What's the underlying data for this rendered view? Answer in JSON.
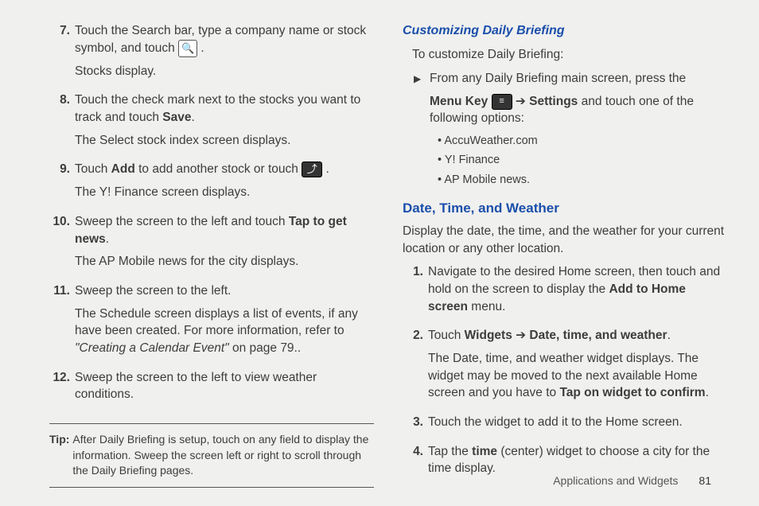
{
  "left": {
    "items": [
      {
        "num": "7.",
        "paras": [
          {
            "segments": [
              {
                "text": "Touch the Search bar, type a company name or stock symbol, and touch "
              },
              {
                "icon": "search"
              },
              {
                "text": " ."
              }
            ]
          },
          {
            "segments": [
              {
                "text": "Stocks display."
              }
            ]
          }
        ]
      },
      {
        "num": "8.",
        "paras": [
          {
            "segments": [
              {
                "text": "Touch the check mark next to the stocks you want to track and touch "
              },
              {
                "bold": true,
                "text": "Save"
              },
              {
                "text": "."
              }
            ]
          },
          {
            "segments": [
              {
                "text": "The Select stock index screen displays."
              }
            ]
          }
        ]
      },
      {
        "num": "9.",
        "paras": [
          {
            "segments": [
              {
                "text": "Touch "
              },
              {
                "bold": true,
                "text": "Add"
              },
              {
                "text": " to add another stock or touch "
              },
              {
                "icon": "return"
              },
              {
                "text": " ."
              }
            ]
          },
          {
            "segments": [
              {
                "text": "The Y! Finance screen displays."
              }
            ]
          }
        ]
      },
      {
        "num": "10.",
        "paras": [
          {
            "segments": [
              {
                "text": "Sweep the screen to the left and touch "
              },
              {
                "bold": true,
                "text": "Tap to get news"
              },
              {
                "text": "."
              }
            ]
          },
          {
            "segments": [
              {
                "text": "The AP Mobile news for the city displays."
              }
            ]
          }
        ]
      },
      {
        "num": "11.",
        "paras": [
          {
            "segments": [
              {
                "text": "Sweep the screen to the left."
              }
            ]
          },
          {
            "segments": [
              {
                "text": "The Schedule screen displays a list of events, if any have been created. For more information, refer to "
              },
              {
                "italic": true,
                "text": "\"Creating a Calendar Event\""
              },
              {
                "text": "  on page 79.."
              }
            ]
          }
        ]
      },
      {
        "num": "12.",
        "paras": [
          {
            "segments": [
              {
                "text": "Sweep the screen to the left to view weather conditions."
              }
            ]
          }
        ]
      }
    ],
    "tip_label": "Tip:",
    "tip_text": "After Daily Briefing is setup, touch on any field to display the information. Sweep the screen left or right to scroll through the Daily Briefing pages."
  },
  "right": {
    "customizing_title": "Customizing Daily Briefing",
    "customizing_intro": "To customize Daily Briefing:",
    "customizing_step": {
      "segments": [
        {
          "text": "From any Daily Briefing main screen, press the "
        }
      ],
      "segments2": [
        {
          "bold": true,
          "text": "Menu Key"
        },
        {
          "text": " "
        },
        {
          "icon": "menu"
        },
        {
          "text": " ➔ "
        },
        {
          "bold": true,
          "text": "Settings"
        },
        {
          "text": " and touch one of the following options:"
        }
      ],
      "bullets": [
        "AccuWeather.com",
        "Y! Finance",
        "AP Mobile news."
      ]
    },
    "dtw_title": "Date, Time, and Weather",
    "dtw_intro": "Display the date, the time, and the weather for your current location or any other location.",
    "dtw_items": [
      {
        "num": "1.",
        "paras": [
          {
            "segments": [
              {
                "text": "Navigate to the desired Home screen, then touch and hold on the screen to display the "
              },
              {
                "bold": true,
                "text": "Add to Home screen"
              },
              {
                "text": " menu."
              }
            ]
          }
        ]
      },
      {
        "num": "2.",
        "paras": [
          {
            "segments": [
              {
                "text": "Touch "
              },
              {
                "bold": true,
                "text": "Widgets"
              },
              {
                "text": " ➔ "
              },
              {
                "bold": true,
                "text": "Date, time, and weather"
              },
              {
                "text": "."
              }
            ]
          },
          {
            "segments": [
              {
                "text": "The Date, time, and weather widget displays. The widget may be moved to the next available Home screen and you have to "
              },
              {
                "bold": true,
                "text": "Tap on widget to confirm"
              },
              {
                "text": "."
              }
            ]
          }
        ]
      },
      {
        "num": "3.",
        "paras": [
          {
            "segments": [
              {
                "text": "Touch the widget to add it to the Home screen."
              }
            ]
          }
        ]
      },
      {
        "num": "4.",
        "paras": [
          {
            "segments": [
              {
                "text": "Tap the "
              },
              {
                "bold": true,
                "text": "time"
              },
              {
                "text": " (center) widget to choose a city for the time display."
              }
            ]
          }
        ]
      }
    ]
  },
  "footer": {
    "section": "Applications and Widgets",
    "page": "81"
  },
  "icons": {
    "search": "🔍",
    "return": "⤴",
    "menu": "≡"
  }
}
